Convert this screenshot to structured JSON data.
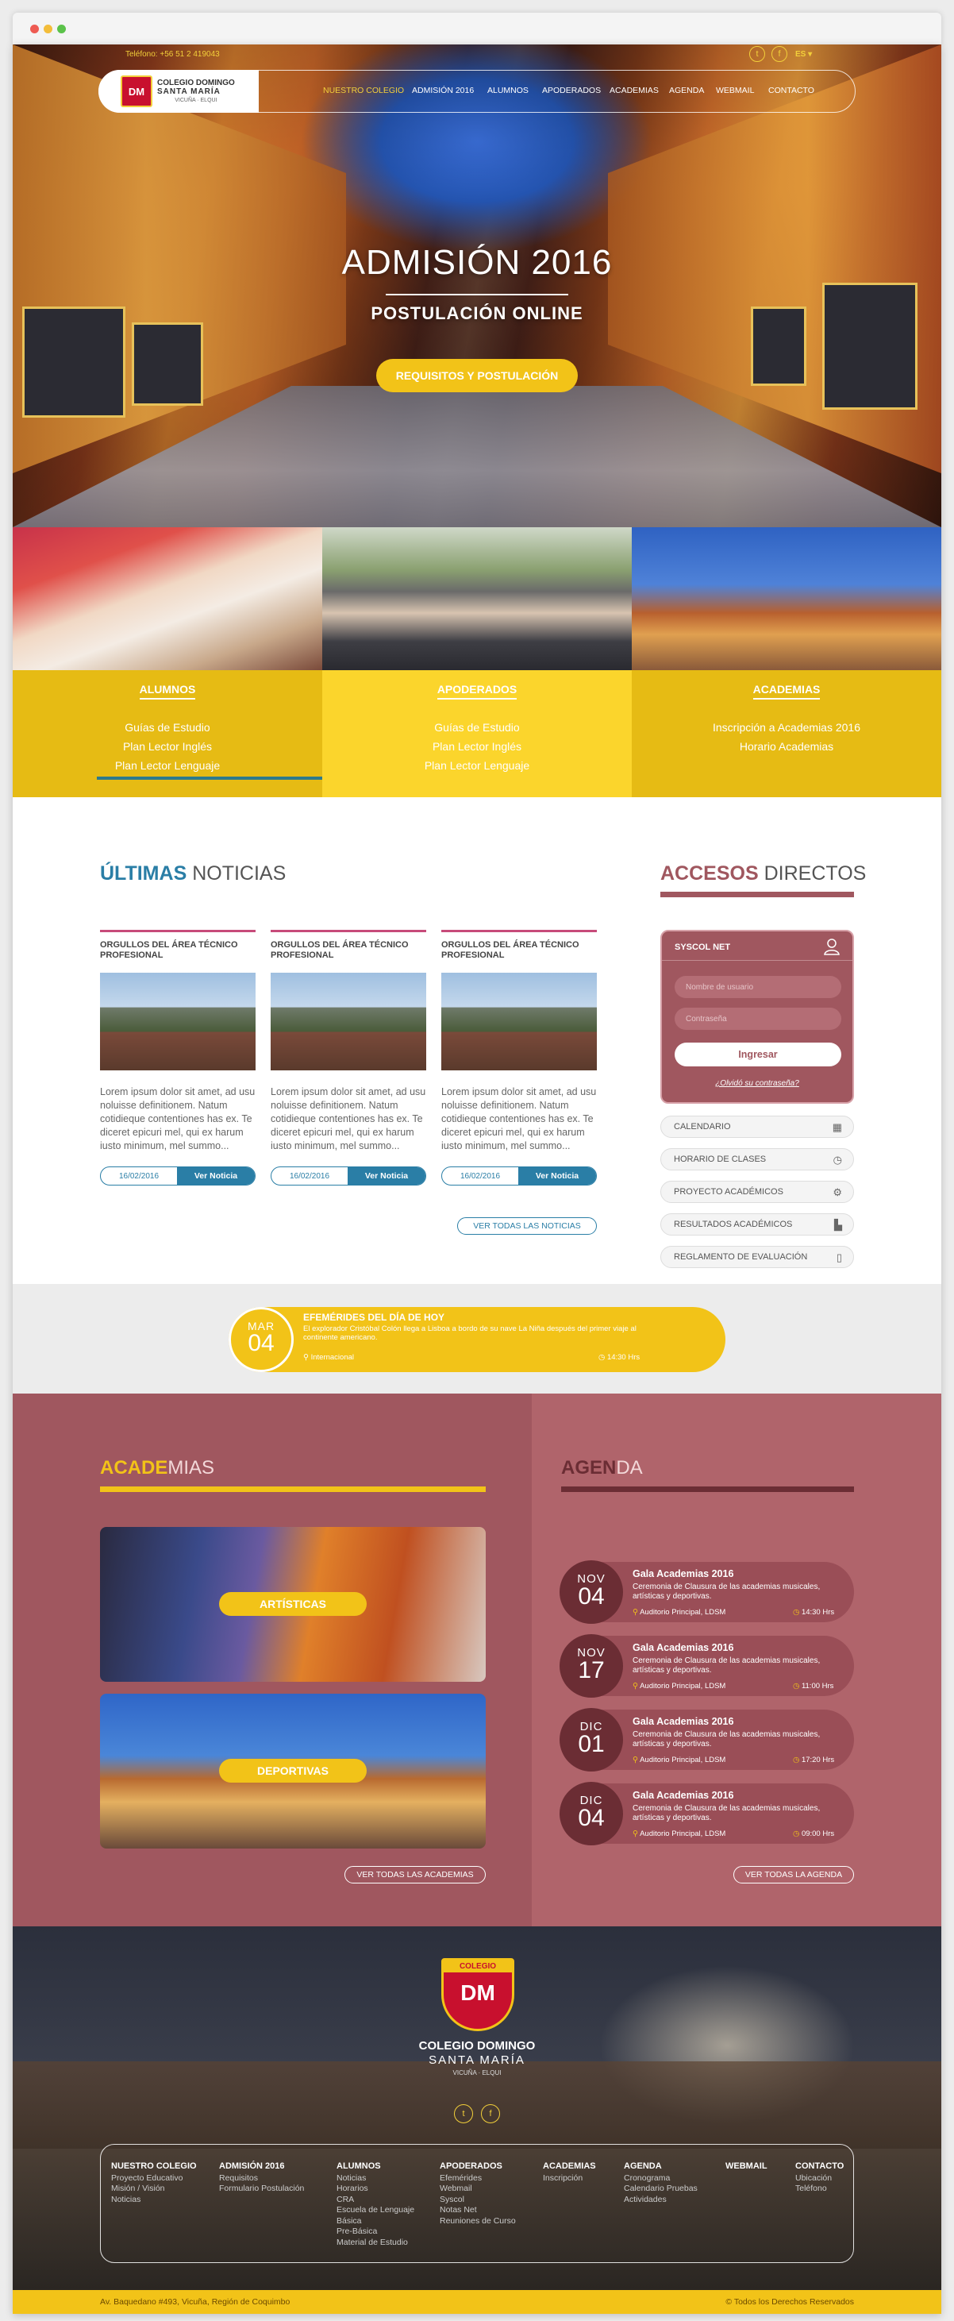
{
  "topbar": {
    "phone": "Teléfono: +56 51 2 419043",
    "lang": "ES"
  },
  "brand": {
    "name_line1": "COLEGIO DOMINGO",
    "name_line2": "SANTA MARÍA",
    "location": "VICUÑA · ELQUI",
    "monogram": "DM",
    "shield_word": "COLEGIO"
  },
  "nav": [
    "NUESTRO COLEGIO",
    "ADMISIÓN 2016",
    "ALUMNOS",
    "APODERADOS",
    "ACADEMIAS",
    "AGENDA",
    "WEBMAIL",
    "CONTACTO"
  ],
  "hero": {
    "title": "ADMISIÓN 2016",
    "subtitle": "POSTULACIÓN ONLINE",
    "button": "REQUISITOS Y POSTULACIÓN"
  },
  "categories": [
    {
      "title": "ALUMNOS",
      "links": [
        "Guías de Estudio",
        "Plan Lector Inglés",
        "Plan Lector Lenguaje"
      ]
    },
    {
      "title": "APODERADOS",
      "links": [
        "Guías de Estudio",
        "Plan Lector Inglés",
        "Plan Lector Lenguaje"
      ]
    },
    {
      "title": "ACADEMIAS",
      "links": [
        "Inscripción a Academias 2016",
        "Horario Academias"
      ]
    }
  ],
  "news": {
    "title_bold": "ÚLTIMAS",
    "title_rest": " NOTICIAS",
    "items": [
      {
        "headline": "ORGULLOS DEL ÁREA TÉCNICO PROFESIONAL",
        "body": "Lorem ipsum dolor sit amet, ad usu noluisse definitionem. Natum cotidieque contentiones has ex. Te diceret epicuri mel, qui ex harum iusto minimum, mel summo...",
        "date": "16/02/2016",
        "link": "Ver Noticia"
      },
      {
        "headline": "ORGULLOS DEL ÁREA TÉCNICO PROFESIONAL",
        "body": "Lorem ipsum dolor sit amet, ad usu noluisse definitionem. Natum cotidieque contentiones has ex. Te diceret epicuri mel, qui ex harum iusto minimum, mel summo...",
        "date": "16/02/2016",
        "link": "Ver Noticia"
      },
      {
        "headline": "ORGULLOS DEL ÁREA TÉCNICO PROFESIONAL",
        "body": "Lorem ipsum dolor sit amet, ad usu noluisse definitionem. Natum cotidieque contentiones has ex. Te diceret epicuri mel, qui ex harum iusto minimum, mel summo...",
        "date": "16/02/2016",
        "link": "Ver Noticia"
      }
    ],
    "all_button": "VER TODAS LAS NOTICIAS"
  },
  "accesos": {
    "title_bold": "ACCESOS",
    "title_rest": " DIRECTOS",
    "syscol": {
      "title": "SYSCOL NET",
      "user_placeholder": "Nombre de usuario",
      "pass_placeholder": "Contraseña",
      "button": "Ingresar",
      "forgot": "¿Olvidó su contraseña?"
    },
    "items": [
      "CALENDARIO",
      "HORARIO DE CLASES",
      "PROYECTO ACADÉMICOS",
      "RESULTADOS ACADÉMICOS",
      "REGLAMENTO DE EVALUACIÓN"
    ]
  },
  "efemerides": {
    "month": "MAR",
    "day": "04",
    "title": "EFEMÉRIDES DEL DÍA DE HOY",
    "text": "El explorador Cristóbal Colón llega a Lisboa a bordo de su nave La Niña después del primer viaje al continente americano.",
    "place": "Internacional",
    "time": "14:30 Hrs"
  },
  "academias": {
    "title_bold": "ACADE",
    "title_rest": "MIAS",
    "cards": [
      "ARTÍSTICAS",
      "DEPORTIVAS"
    ],
    "all_button": "VER TODAS LAS ACADEMIAS"
  },
  "agenda": {
    "title_bold": "AGEN",
    "title_rest": "DA",
    "items": [
      {
        "month": "NOV",
        "day": "04",
        "title": "Gala Academias 2016",
        "desc": "Ceremonia de Clausura de las academias musicales, artísticas y deportivas.",
        "place": "Auditorio Principal, LDSM",
        "time": "14:30 Hrs"
      },
      {
        "month": "NOV",
        "day": "17",
        "title": "Gala Academias 2016",
        "desc": "Ceremonia de Clausura de las academias musicales, artísticas y deportivas.",
        "place": "Auditorio Principal, LDSM",
        "time": "11:00 Hrs"
      },
      {
        "month": "DIC",
        "day": "01",
        "title": "Gala Academias 2016",
        "desc": "Ceremonia de Clausura de las academias musicales, artísticas y deportivas.",
        "place": "Auditorio Principal, LDSM",
        "time": "17:20 Hrs"
      },
      {
        "month": "DIC",
        "day": "04",
        "title": "Gala Academias 2016",
        "desc": "Ceremonia de Clausura de las academias musicales, artísticas y deportivas.",
        "place": "Auditorio Principal, LDSM",
        "time": "09:00 Hrs"
      }
    ],
    "all_button": "VER TODAS LA AGENDA"
  },
  "footer": {
    "cols": [
      {
        "title": "NUESTRO COLEGIO",
        "links": [
          "Proyecto Educativo",
          "Misión / Visión",
          "Noticias"
        ]
      },
      {
        "title": "ADMISIÓN 2016",
        "links": [
          "Requisitos",
          "Formulario Postulación"
        ]
      },
      {
        "title": "ALUMNOS",
        "links": [
          "Noticias",
          "Horarios",
          "CRA",
          "Escuela de Lenguaje",
          "Básica",
          "Pre-Básica",
          "Material de Estudio"
        ]
      },
      {
        "title": "APODERADOS",
        "links": [
          "Efemérides",
          "Webmail",
          "Syscol",
          "Notas Net",
          "Reuniones de Curso"
        ]
      },
      {
        "title": "ACADEMIAS",
        "links": [
          "Inscripción"
        ]
      },
      {
        "title": "AGENDA",
        "links": [
          "Cronograma",
          "Calendario Pruebas",
          "Actividades"
        ]
      },
      {
        "title": "WEBMAIL",
        "links": []
      },
      {
        "title": "CONTACTO",
        "links": [
          "Ubicación",
          "Teléfono"
        ]
      }
    ],
    "address": "Av. Baquedano #493, Vicuña, Región de Coquimbo",
    "rights": "© Todos los Derechos Reservados"
  },
  "colors": {
    "yellow": "#f2c318",
    "blue": "#2a7ea6",
    "maroon": "#a0575f",
    "pink": "#c74b7a"
  }
}
